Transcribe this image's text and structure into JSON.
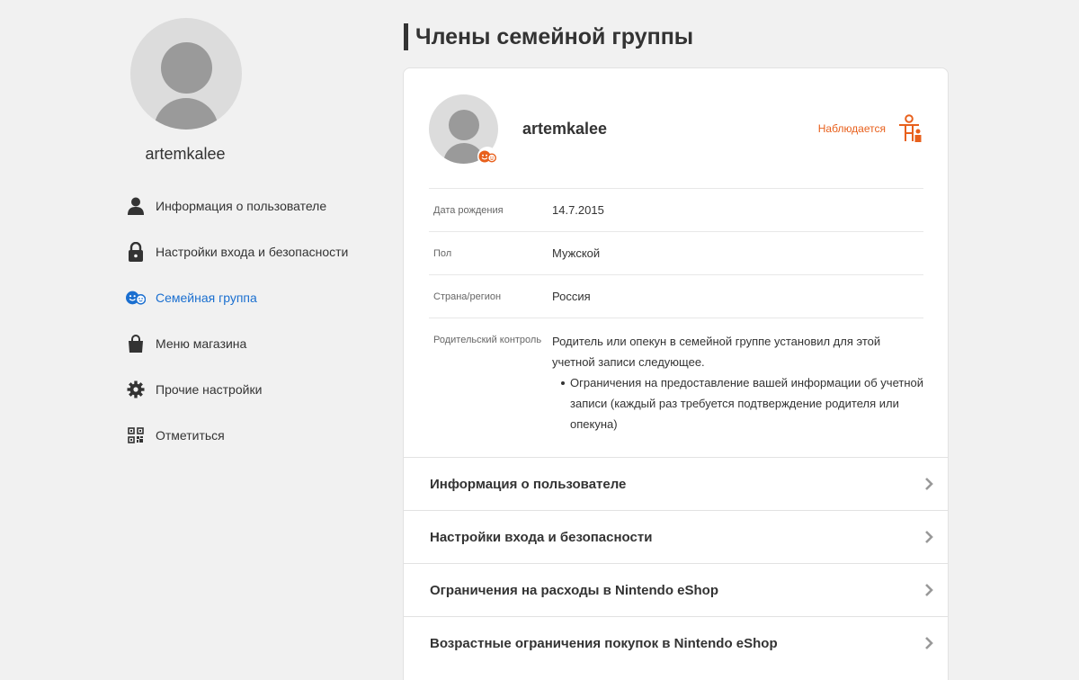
{
  "sidebar": {
    "username": "artemkalee",
    "items": [
      {
        "label": "Информация о пользователе",
        "icon": "person-icon",
        "active": false
      },
      {
        "label": "Настройки входа и безопасности",
        "icon": "lock-icon",
        "active": false
      },
      {
        "label": "Семейная группа",
        "icon": "family-icon",
        "active": true
      },
      {
        "label": "Меню магазина",
        "icon": "shopping-bag-icon",
        "active": false
      },
      {
        "label": "Прочие настройки",
        "icon": "gear-icon",
        "active": false
      },
      {
        "label": "Отметиться",
        "icon": "qr-code-icon",
        "active": false
      }
    ]
  },
  "main": {
    "title": "Члены семейной группы",
    "member": {
      "name": "artemkalee",
      "status": "Наблюдается",
      "status_icon": "supervised-child-icon",
      "badge_icon": "child-account-icon"
    },
    "info": [
      {
        "label": "Дата рождения",
        "value": "14.7.2015"
      },
      {
        "label": "Пол",
        "value": "Мужской"
      },
      {
        "label": "Страна/регион",
        "value": "Россия"
      }
    ],
    "parental": {
      "label": "Родительский контроль",
      "text": "Родитель или опекун в семейной группе установил для этой учетной записи следующее.",
      "restrictions": [
        "Ограничения на предоставление вашей информации об учетной записи (каждый раз требуется подтверждение родителя или опекуна)"
      ]
    },
    "links": [
      {
        "label": "Информация о пользователе"
      },
      {
        "label": "Настройки входа и безопасности"
      },
      {
        "label": "Ограничения на расходы в Nintendo eShop"
      },
      {
        "label": "Возрастные ограничения покупок в Nintendo eShop"
      }
    ]
  },
  "colors": {
    "accent_blue": "#1a6fd0",
    "accent_orange": "#e8601c",
    "background": "#f1f1f1"
  }
}
